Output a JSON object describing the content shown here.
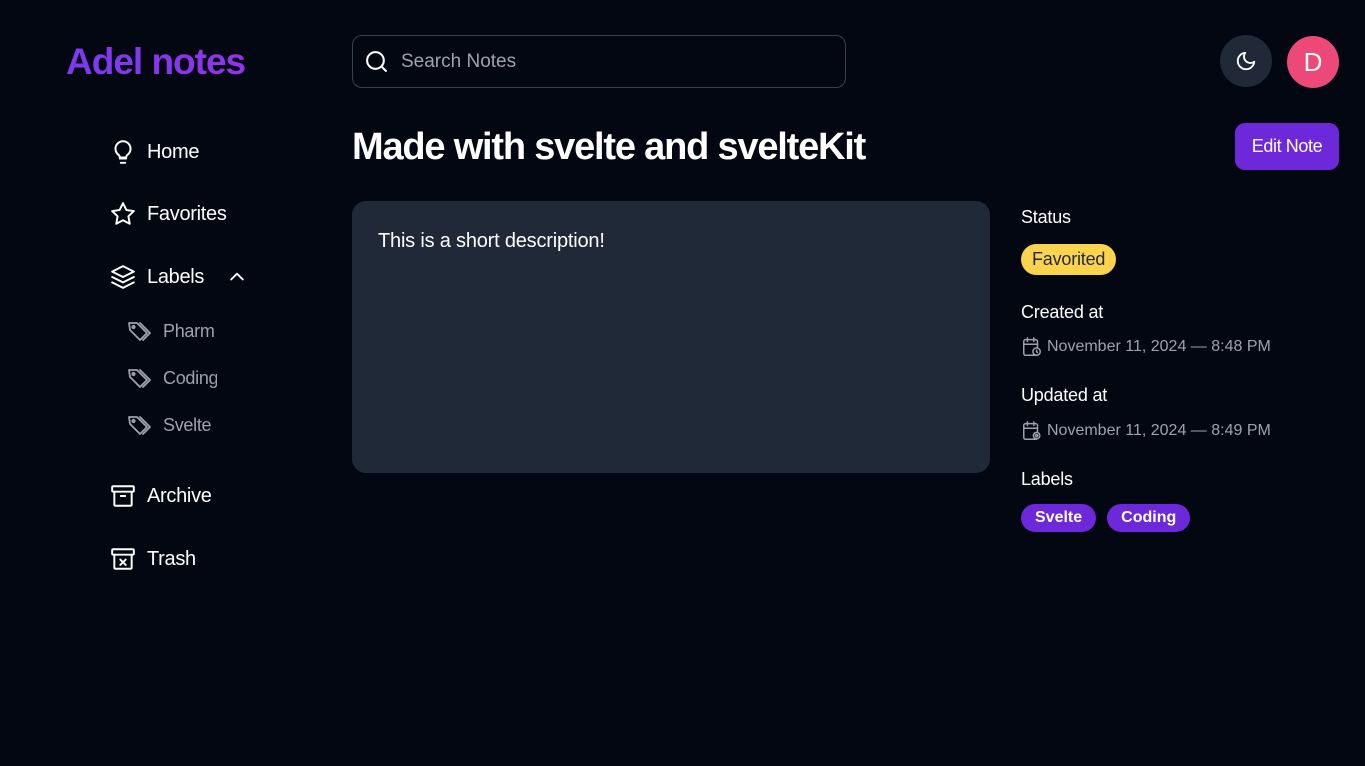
{
  "app": {
    "logo": "Adel notes"
  },
  "sidebar": {
    "items": [
      {
        "label": "Home",
        "icon": "lightbulb-icon"
      },
      {
        "label": "Favorites",
        "icon": "star-icon"
      },
      {
        "label": "Labels",
        "icon": "layers-icon",
        "expanded": true
      },
      {
        "label": "Archive",
        "icon": "archive-icon"
      },
      {
        "label": "Trash",
        "icon": "trash-icon"
      }
    ],
    "labels": [
      {
        "label": "Pharm",
        "icon": "tag-icon"
      },
      {
        "label": "Coding",
        "icon": "tag-icon"
      },
      {
        "label": "Svelte",
        "icon": "tag-icon"
      }
    ]
  },
  "header": {
    "search_placeholder": "Search Notes",
    "theme_icon": "moon-icon",
    "avatar_initial": "D"
  },
  "note": {
    "title": "Made with svelte and svelteKit",
    "edit_label": "Edit Note",
    "description": "This is a short description!"
  },
  "details": {
    "status_heading": "Status",
    "status_value": "Favorited",
    "created_heading": "Created at",
    "created_value": "November 11, 2024 — 8:48 PM",
    "updated_heading": "Updated at",
    "updated_value": "November 11, 2024 — 8:49 PM",
    "labels_heading": "Labels",
    "labels": [
      "Svelte",
      "Coding"
    ]
  },
  "colors": {
    "background": "#030712",
    "brand": "#7c3aed",
    "accent": "#6d28d9",
    "card": "#1f2937",
    "favorite_badge": "#fcd34d",
    "avatar": "#ec4878"
  }
}
